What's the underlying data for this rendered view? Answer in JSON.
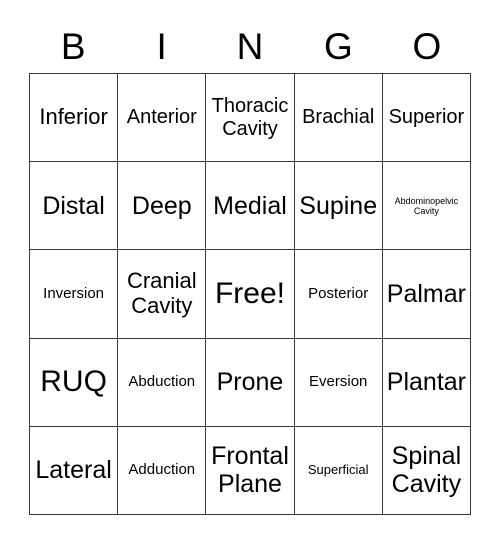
{
  "card": {
    "title": "BINGO",
    "header_letters": [
      "B",
      "I",
      "N",
      "G",
      "O"
    ],
    "columns": 5,
    "rows": 5,
    "free_space": "Free!",
    "grid": [
      [
        {
          "label": "Inferior",
          "size": "l"
        },
        {
          "label": "Anterior",
          "size": "m"
        },
        {
          "label": "Thoracic\nCavity",
          "size": "m"
        },
        {
          "label": "Brachial",
          "size": "m"
        },
        {
          "label": "Superior",
          "size": "m"
        }
      ],
      [
        {
          "label": "Distal",
          "size": "xl"
        },
        {
          "label": "Deep",
          "size": "xl"
        },
        {
          "label": "Medial",
          "size": "xl"
        },
        {
          "label": "Supine",
          "size": "xl"
        },
        {
          "label": "Abdominopelvic\nCavity",
          "size": "xxs"
        }
      ],
      [
        {
          "label": "Inversion",
          "size": "s"
        },
        {
          "label": "Cranial\nCavity",
          "size": "l"
        },
        {
          "label": "Free!",
          "size": "xxl"
        },
        {
          "label": "Posterior",
          "size": "s"
        },
        {
          "label": "Palmar",
          "size": "xl"
        }
      ],
      [
        {
          "label": "RUQ",
          "size": "xxl"
        },
        {
          "label": "Abduction",
          "size": "s"
        },
        {
          "label": "Prone",
          "size": "xl"
        },
        {
          "label": "Eversion",
          "size": "s"
        },
        {
          "label": "Plantar",
          "size": "xl"
        }
      ],
      [
        {
          "label": "Lateral",
          "size": "xl"
        },
        {
          "label": "Adduction",
          "size": "s"
        },
        {
          "label": "Frontal\nPlane",
          "size": "xl"
        },
        {
          "label": "Superficial",
          "size": "xs"
        },
        {
          "label": "Spinal\nCavity",
          "size": "xl"
        }
      ]
    ]
  },
  "colors": {
    "background": "#ffffff",
    "text": "#000000",
    "border": "#3a3a3a"
  }
}
